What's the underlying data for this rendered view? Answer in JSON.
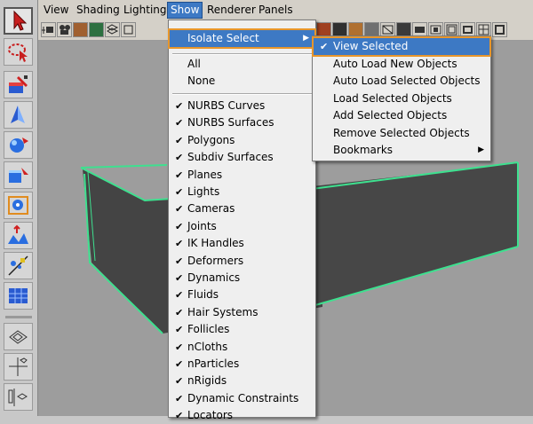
{
  "menubar": {
    "items": [
      {
        "label": "View"
      },
      {
        "label": "Shading"
      },
      {
        "label": "Lighting"
      },
      {
        "label": "Show"
      },
      {
        "label": "Renderer"
      },
      {
        "label": "Panels"
      }
    ],
    "open_item": "Show"
  },
  "show_menu": {
    "isolate_select_label": "Isolate Select",
    "all_label": "All",
    "none_label": "None",
    "items": [
      {
        "label": "NURBS Curves",
        "checked": true
      },
      {
        "label": "NURBS Surfaces",
        "checked": true
      },
      {
        "label": "Polygons",
        "checked": true
      },
      {
        "label": "Subdiv Surfaces",
        "checked": true
      },
      {
        "label": "Planes",
        "checked": true
      },
      {
        "label": "Lights",
        "checked": true
      },
      {
        "label": "Cameras",
        "checked": true
      },
      {
        "label": "Joints",
        "checked": true
      },
      {
        "label": "IK Handles",
        "checked": true
      },
      {
        "label": "Deformers",
        "checked": true
      },
      {
        "label": "Dynamics",
        "checked": true
      },
      {
        "label": "Fluids",
        "checked": true
      },
      {
        "label": "Hair Systems",
        "checked": true
      },
      {
        "label": "Follicles",
        "checked": true
      },
      {
        "label": "nCloths",
        "checked": true
      },
      {
        "label": "nParticles",
        "checked": true
      },
      {
        "label": "nRigids",
        "checked": true
      },
      {
        "label": "Dynamic Constraints",
        "checked": true
      },
      {
        "label": "Locators",
        "checked": true
      }
    ]
  },
  "isolate_menu": {
    "items": [
      {
        "label": "View Selected",
        "checked": true
      },
      {
        "label": "Auto Load New Objects",
        "checked": false
      },
      {
        "label": "Auto Load Selected Objects",
        "checked": false
      },
      {
        "label": "Load Selected Objects",
        "checked": false
      },
      {
        "label": "Add Selected Objects",
        "checked": false
      },
      {
        "label": "Remove Selected Objects",
        "checked": false
      },
      {
        "label": "Bookmarks",
        "checked": false,
        "submenu": true
      }
    ]
  },
  "glyphs": {
    "check": "✔",
    "submenu_arrow": "▶"
  },
  "colors": {
    "menu_highlight": "#3d79c4",
    "highlight_outline": "#e8962b",
    "selection_wire": "#3ee08f",
    "object_face": "#444444",
    "viewport_bg": "#9d9d9d"
  },
  "toolbox": {
    "tools": [
      {
        "name": "select-tool-icon"
      },
      {
        "name": "lasso-tool-icon"
      },
      {
        "name": "paint-select-tool-icon"
      },
      {
        "name": "move-tool-icon"
      },
      {
        "name": "rotate-tool-icon"
      },
      {
        "name": "scale-tool-icon"
      },
      {
        "name": "universal-manipulator-icon"
      },
      {
        "name": "soft-modification-icon"
      },
      {
        "name": "show-manipulator-icon"
      },
      {
        "name": "last-tool-icon"
      }
    ]
  }
}
